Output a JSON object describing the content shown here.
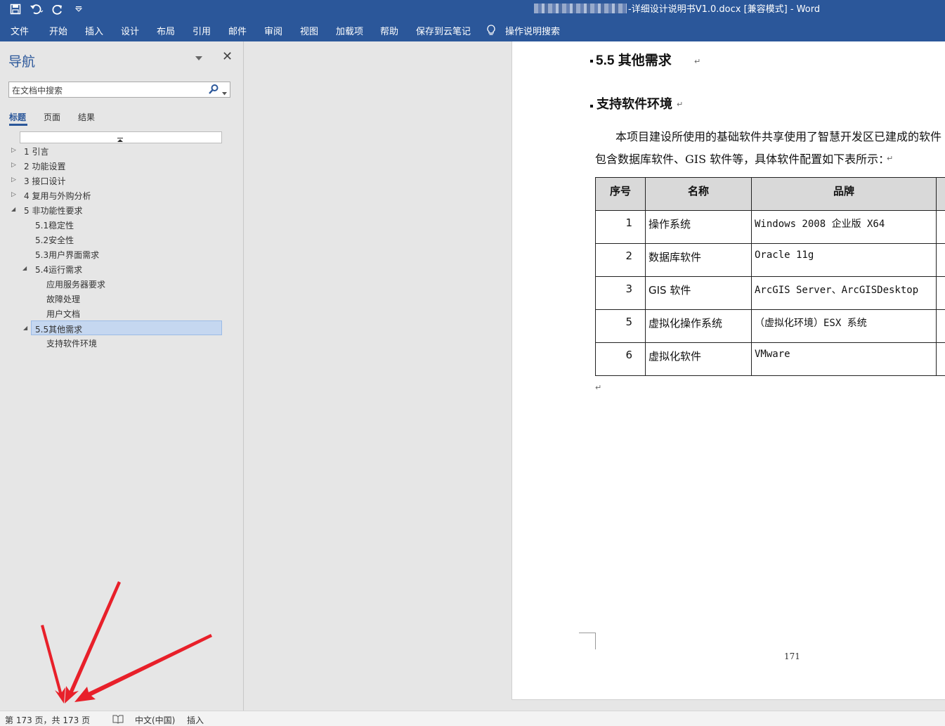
{
  "window": {
    "title": "-详细设计说明书V1.0.docx [兼容模式]  -  Word"
  },
  "ribbon": {
    "tabs": [
      "文件",
      "开始",
      "插入",
      "设计",
      "布局",
      "引用",
      "邮件",
      "审阅",
      "视图",
      "加载项",
      "帮助",
      "保存到云笔记",
      "操作说明搜索"
    ]
  },
  "nav": {
    "title": "导航",
    "search_placeholder": "在文档中搜索",
    "subtabs": [
      "标题",
      "页面",
      "结果"
    ],
    "tree": [
      {
        "label": "1 引言",
        "level": 1,
        "expanded": false
      },
      {
        "label": "2 功能设置",
        "level": 1,
        "expanded": false
      },
      {
        "label": "3 接口设计",
        "level": 1,
        "expanded": false
      },
      {
        "label": "4 复用与外购分析",
        "level": 1,
        "expanded": false
      },
      {
        "label": "5 非功能性要求",
        "level": 1,
        "expanded": true
      },
      {
        "label": "5.1稳定性",
        "level": 2
      },
      {
        "label": "5.2安全性",
        "level": 2
      },
      {
        "label": "5.3用户界面需求",
        "level": 2
      },
      {
        "label": "5.4运行需求",
        "level": 2,
        "expanded": true
      },
      {
        "label": "应用服务器要求",
        "level": 3
      },
      {
        "label": "故障处理",
        "level": 3
      },
      {
        "label": "用户文档",
        "level": 3
      },
      {
        "label": "5.5其他需求",
        "level": 2,
        "expanded": true,
        "selected": true
      },
      {
        "label": "支持软件环境",
        "level": 3
      }
    ]
  },
  "document": {
    "heading_2": "5.5 其他需求",
    "heading_3": "支持软件环境",
    "para_line1": "本项目建设所使用的基础软件共享使用了智慧开发区已建成的软件",
    "para_line2": "包含数据库软件、GIS 软件等，具体软件配置如下表所示：",
    "table": {
      "headers": [
        "序号",
        "名称",
        "品牌"
      ],
      "rows": [
        [
          "1",
          "操作系统",
          "Windows 2008 企业版 X64"
        ],
        [
          "2",
          "数据库软件",
          "Oracle 11g"
        ],
        [
          "3",
          "GIS 软件",
          "ArcGIS Server、ArcGISDesktop"
        ],
        [
          "5",
          "虚拟化操作系统",
          "（虚拟化环境）ESX 系统"
        ],
        [
          "6",
          "虚拟化软件",
          "VMware"
        ]
      ]
    },
    "page_number": "171"
  },
  "status": {
    "page_info": "第 173 页，共 173 页",
    "language": "中文(中国)",
    "mode": "插入"
  }
}
